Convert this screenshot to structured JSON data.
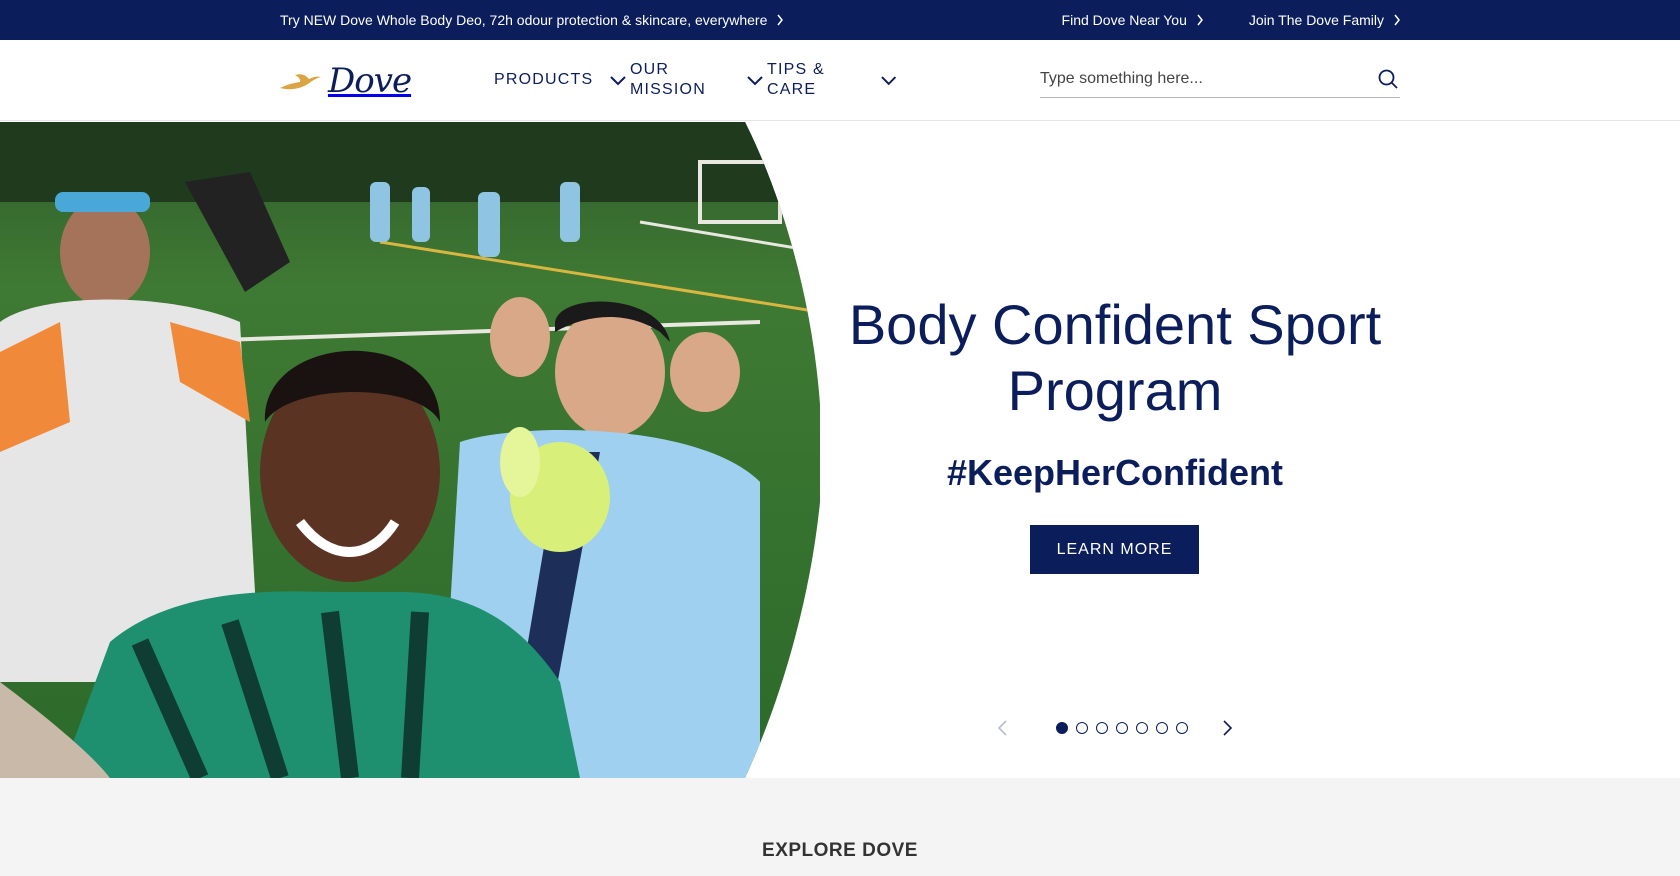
{
  "promo": {
    "left_text": "Try NEW Dove Whole Body Deo, 72h odour protection & skincare, everywhere",
    "find_near": "Find Dove Near You",
    "join_family": "Join The Dove Family"
  },
  "header": {
    "logo_text": "Dove",
    "nav": [
      {
        "label": "PRODUCTS"
      },
      {
        "label": "OUR MISSION"
      },
      {
        "label": "TIPS & CARE"
      }
    ],
    "search_placeholder": "Type something here..."
  },
  "hero": {
    "title": "Body Confident Sport Program",
    "subtitle": "#KeepHerConfident",
    "cta": "LEARN MORE",
    "slide_count": 7,
    "active_slide": 1
  },
  "explore": {
    "title": "EXPLORE DOVE"
  },
  "colors": {
    "brand_navy": "#0b1e5b",
    "gold": "#d9a441",
    "explore_bg": "#f4f4f4"
  }
}
